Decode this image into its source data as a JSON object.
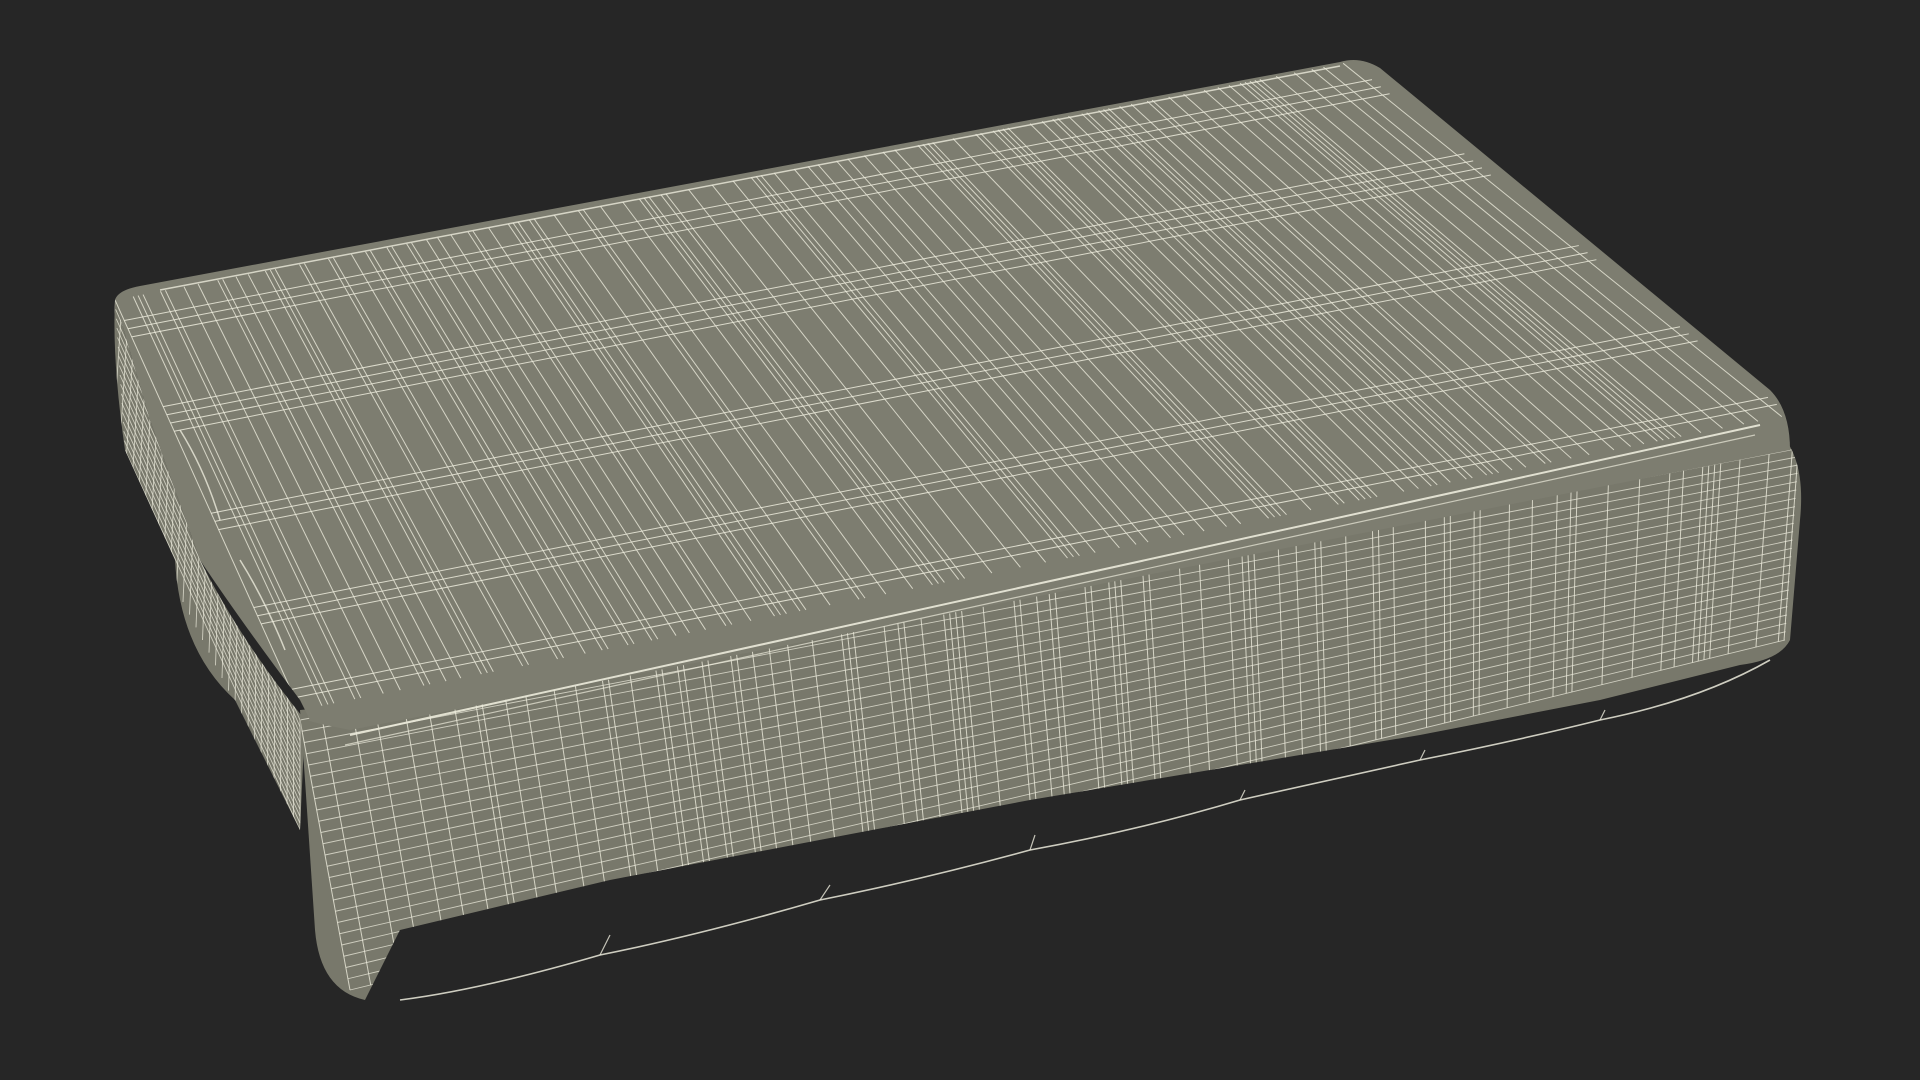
{
  "scene": {
    "subject": "wireframe-cushion",
    "colors": {
      "background": "#262626",
      "surface": "#7d7d70",
      "surface_dark": "#6f6f63",
      "side": "#78786b",
      "wire": "#ecebdc"
    }
  }
}
